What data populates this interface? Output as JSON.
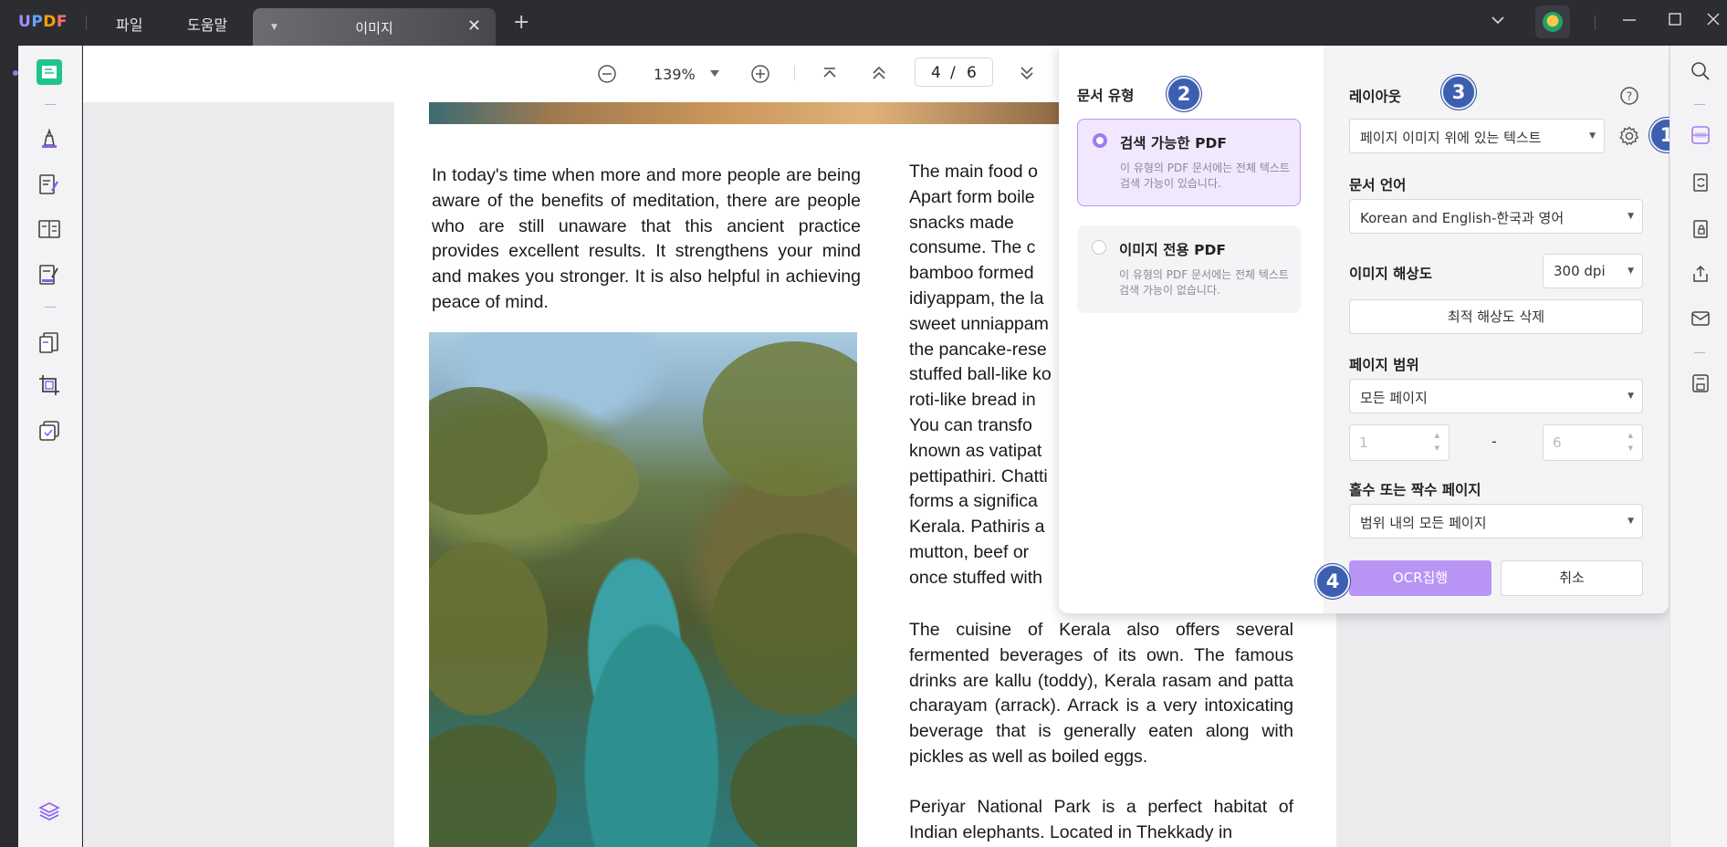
{
  "app": {
    "logo": "UPDF"
  },
  "menu": {
    "file": "파일",
    "help": "도움말"
  },
  "tab": {
    "label": "이미지"
  },
  "nav": {
    "zoom": "139%",
    "page_current": "4",
    "page_sep": "/",
    "page_total": "6"
  },
  "document": {
    "left_paragraph": "In today's time when more and more people are being aware of the benefits of meditation, there are people who are still unaware that this ancient practice provides excellent results. It strengthens your mind and makes you stronger. It is also helpful in achieving peace of mind.",
    "right_lines": [
      "The main food o",
      "Apart form boile",
      "snacks made",
      "consume. The c",
      "bamboo formed",
      "idiyappam, the la",
      "sweet unniappam",
      "the pancake-rese",
      "stuffed ball-like ko",
      "roti-like bread in",
      "You can transfo",
      "known as vatipat",
      "pettipathiri. Chatti",
      "forms a significa",
      "Kerala. Pathiris a",
      "mutton, beef or",
      "once stuffed with"
    ],
    "right_paragraph_2": "The cuisine of Kerala also offers several fermented beverages of its own. The famous drinks are kallu (toddy), Kerala rasam and patta charayam (arrack). Arrack is a very intoxicating beverage that is generally eaten along with pickles as well as boiled eggs.",
    "right_paragraph_3": "Periyar National Park is a perfect habitat of Indian elephants. Located in Thekkady in"
  },
  "ocr": {
    "doc_type_label": "문서 유형",
    "options": [
      {
        "title": "검색 가능한 PDF",
        "desc": "이 유형의 PDF 문서에는 전체 텍스트 검색 가능이 있습니다.",
        "selected": true
      },
      {
        "title": "이미지 전용 PDF",
        "desc": "이 유형의 PDF 문서에는 전체 텍스트 검색 가능이 없습니다.",
        "selected": false
      }
    ],
    "layout_label": "레이아웃",
    "layout_value": "페이지 이미지 위에 있는 텍스트",
    "language_label": "문서 언어",
    "language_value": "Korean and English-한국과 영어",
    "resolution_label": "이미지 해상도",
    "resolution_value": "300 dpi",
    "detect_button": "최적 해상도 삭제",
    "range_label": "페이지 범위",
    "range_value": "모든 페이지",
    "range_from": "1",
    "range_dash": "-",
    "range_to": "6",
    "oddeven_label": "홀수 또는 짝수 페이지",
    "oddeven_value": "범위 내의 모든 페이지",
    "run_button": "OCR집행",
    "cancel_button": "취소"
  },
  "badges": {
    "b1": "1",
    "b2": "2",
    "b3": "3",
    "b4": "4"
  },
  "colors": {
    "accent": "#a179f2",
    "run_button": "#b895f5",
    "badge": "#3d5fb0",
    "titlebar": "#2c2d31"
  }
}
